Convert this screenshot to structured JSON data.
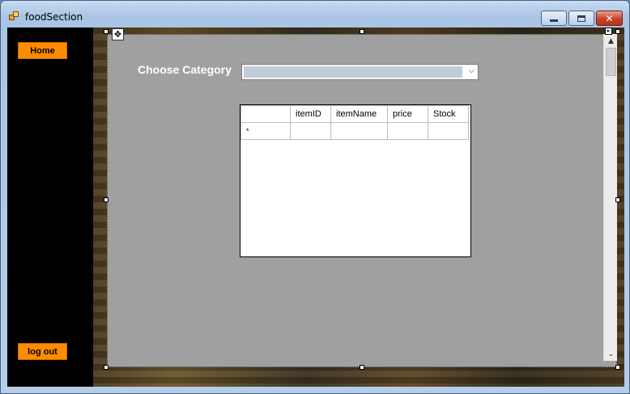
{
  "window": {
    "title": "foodSection",
    "minimize_label": "",
    "maximize_label": "",
    "close_label": "✕"
  },
  "sidebar": {
    "home_label": "Home",
    "logout_label": "log out"
  },
  "form": {
    "choose_category_label": "Choose Category",
    "category_selected": "",
    "dropdown_arrow": "⌵"
  },
  "grid": {
    "columns": [
      "itemID",
      "itemName",
      "price",
      "Stock"
    ],
    "new_row_marker": "*"
  },
  "designer": {
    "move_handle_glyph": "✥",
    "smart_tag_glyph": "▸"
  },
  "scroll": {
    "up_glyph": "▲",
    "down_glyph": "⌄"
  },
  "colors": {
    "accent_button": "#ff8c00",
    "panel": "#a0a0a0",
    "sidebar": "#000000"
  }
}
